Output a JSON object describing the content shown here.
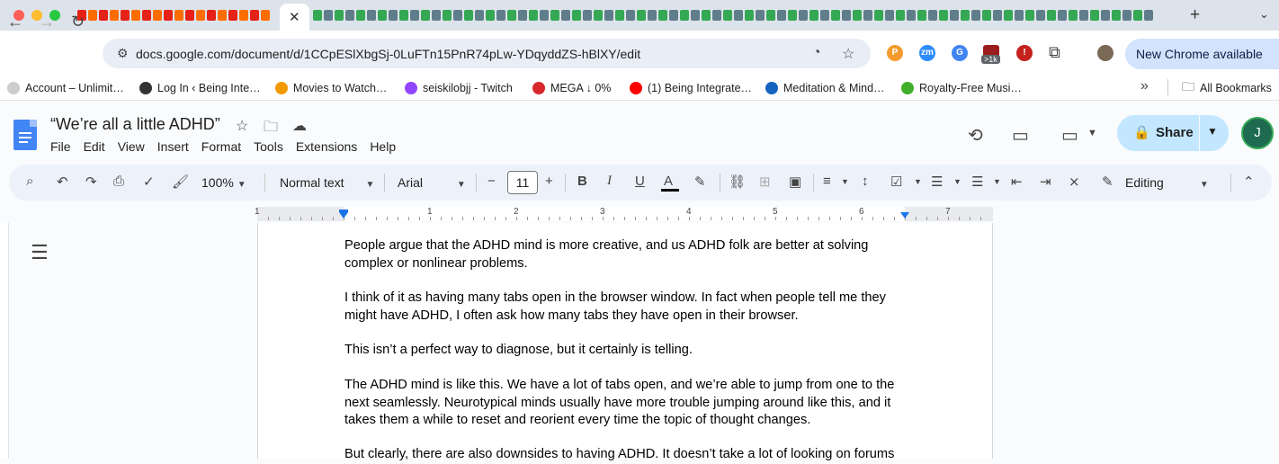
{
  "browser": {
    "active_tab_close": "✕",
    "new_tab": "+",
    "url": "docs.google.com/document/d/1CCpESlXbgSj-0LuFTn15PnR74pLw-YDqyddZS-hBlXY/edit",
    "new_chrome_label": "New Chrome available",
    "extension_badge": ">1k"
  },
  "bookmarks": [
    {
      "label": "Account – Unlimit…",
      "color": "#cccccc"
    },
    {
      "label": "Log In ‹ Being Inte…",
      "color": "#333333"
    },
    {
      "label": "Movies to Watch…",
      "color": "#f29900"
    },
    {
      "label": "seiskilobjj - Twitch",
      "color": "#9146ff"
    },
    {
      "label": "MEGA ↓ 0%",
      "color": "#d9272e"
    },
    {
      "label": "(1) Being Integrate…",
      "color": "#ff0000"
    },
    {
      "label": "Meditation & Mind…",
      "color": "#1565c0"
    },
    {
      "label": "Royalty-Free Musi…",
      "color": "#3fae2a"
    }
  ],
  "all_bookmarks": "All Bookmarks",
  "doc": {
    "title": "“We’re all a little ADHD”",
    "menus": [
      "File",
      "Edit",
      "View",
      "Insert",
      "Format",
      "Tools",
      "Extensions",
      "Help"
    ],
    "share_label": "Share",
    "avatar_letter": "J"
  },
  "toolbar": {
    "zoom": "100%",
    "style": "Normal text",
    "font": "Arial",
    "font_size": "11",
    "mode": "Editing"
  },
  "ruler": {
    "labels": [
      "1",
      "1",
      "2",
      "3",
      "4",
      "5",
      "6",
      "7"
    ]
  },
  "content": {
    "paragraphs": [
      "People argue that the ADHD mind is more creative, and us ADHD folk are better at solving complex or nonlinear problems.",
      "I think of it as having many tabs open in the browser window.  In fact when people tell me they might have ADHD, I often ask how many tabs they have open in their browser.",
      "This isn’t a perfect way to diagnose, but it certainly is telling.",
      "The ADHD mind is like this.  We have a lot of tabs open, and we’re able to jump from one to the next seamlessly.  Neurotypical minds usually have more trouble jumping around like this, and it takes them a while to reset and reorient every time the topic of thought changes.",
      "But clearly, there are also downsides to having ADHD.  It doesn’t take a lot of looking on forums"
    ]
  },
  "colors": {
    "accent": "#1a73e8",
    "share_bg": "#c2e7ff",
    "toolbar_bg": "#edf2fa"
  }
}
